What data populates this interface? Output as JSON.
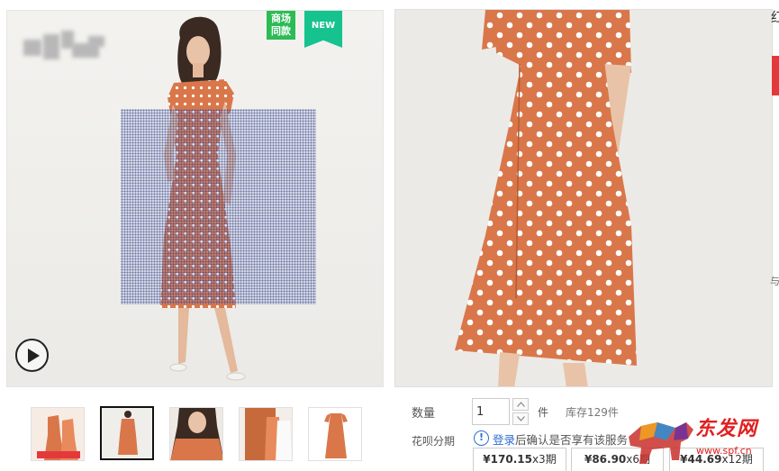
{
  "gallery": {
    "badge_same": "商场同款",
    "badge_new": "NEW"
  },
  "purchase": {
    "quantity_label": "数量",
    "quantity_value": "1",
    "unit": "件",
    "stock": "库存129件",
    "huabei_label": "花呗分期",
    "huabei_login": "登录",
    "huabei_note": "后确认是否享有该服务",
    "plans": [
      {
        "price": "¥170.15",
        "term": "x3期"
      },
      {
        "price": "¥86.90",
        "term": "x6期"
      },
      {
        "price": "¥44.69",
        "term": "x12期"
      }
    ]
  },
  "edge": {
    "top_char": "红",
    "mid_char": "与"
  },
  "watermark": {
    "text": "东发网",
    "url": "www.spf.cn"
  },
  "colors": {
    "dress": "#d9774a",
    "accent_red": "#e4393c",
    "link_blue": "#2b6ed1"
  },
  "icons": [
    "play-icon",
    "info-icon",
    "arrow-up-icon",
    "arrow-down-icon"
  ]
}
